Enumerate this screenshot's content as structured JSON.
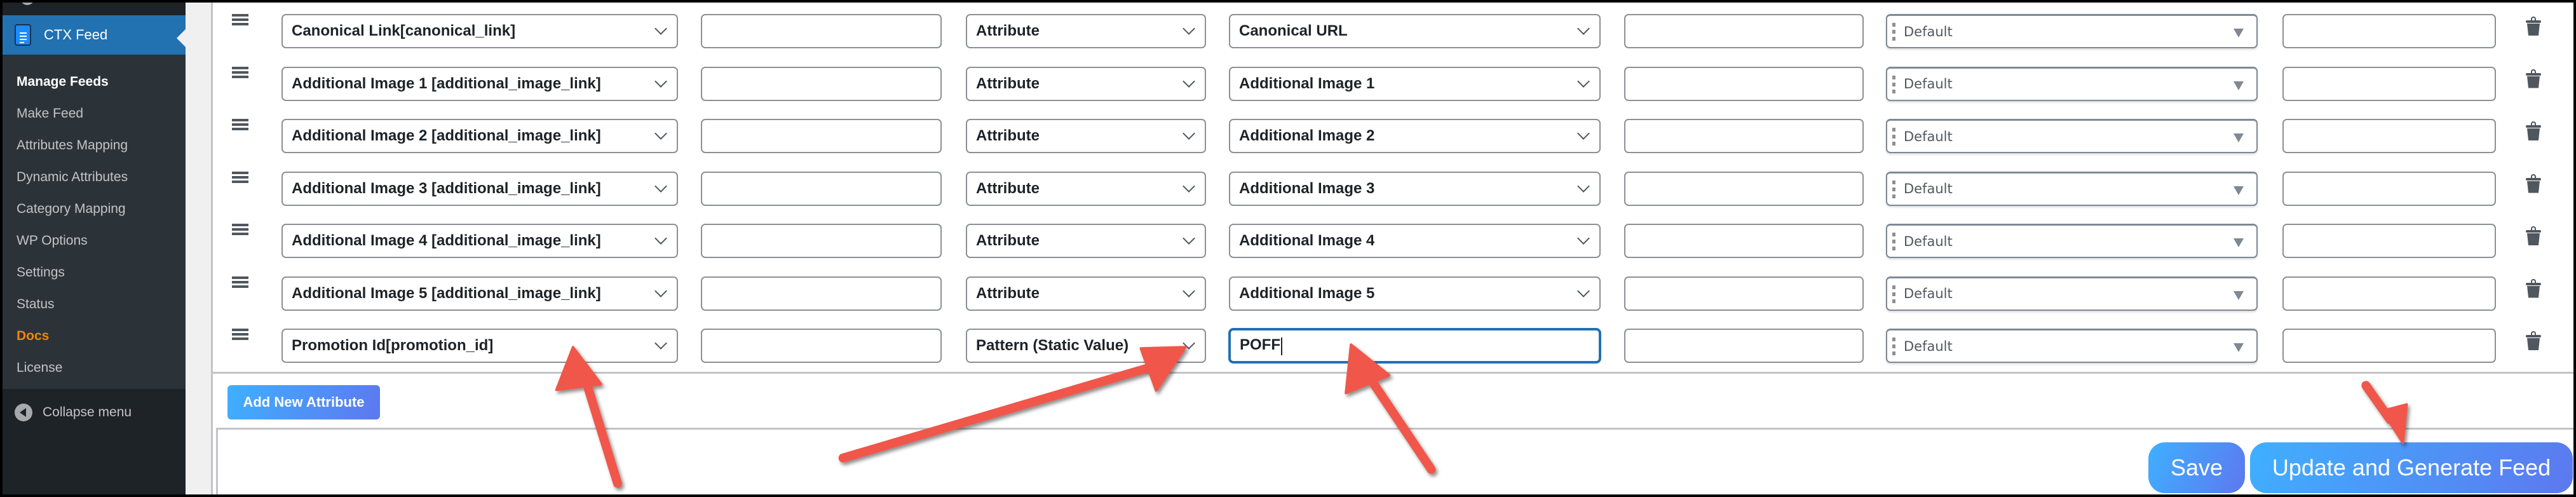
{
  "sidebar": {
    "current_menu": "CTX Feed",
    "items": [
      {
        "label": "Manage Feeds",
        "state": "active"
      },
      {
        "label": "Make Feed"
      },
      {
        "label": "Attributes Mapping"
      },
      {
        "label": "Dynamic Attributes"
      },
      {
        "label": "Category Mapping"
      },
      {
        "label": "WP Options"
      },
      {
        "label": "Settings"
      },
      {
        "label": "Status"
      },
      {
        "label": "Docs",
        "state": "highlighted"
      },
      {
        "label": "License"
      }
    ],
    "collapse_label": "Collapse menu"
  },
  "attributes": {
    "rows": [
      {
        "attribute": "Canonical Link[canonical_link]",
        "prefix": "",
        "type": "Attribute",
        "value": "Canonical URL",
        "suffix": "",
        "output_type": "Default",
        "limit": ""
      },
      {
        "attribute": "Additional Image 1 [additional_image_link]",
        "prefix": "",
        "type": "Attribute",
        "value": "Additional Image 1",
        "suffix": "",
        "output_type": "Default",
        "limit": ""
      },
      {
        "attribute": "Additional Image 2 [additional_image_link]",
        "prefix": "",
        "type": "Attribute",
        "value": "Additional Image 2",
        "suffix": "",
        "output_type": "Default",
        "limit": ""
      },
      {
        "attribute": "Additional Image 3 [additional_image_link]",
        "prefix": "",
        "type": "Attribute",
        "value": "Additional Image 3",
        "suffix": "",
        "output_type": "Default",
        "limit": ""
      },
      {
        "attribute": "Additional Image 4 [additional_image_link]",
        "prefix": "",
        "type": "Attribute",
        "value": "Additional Image 4",
        "suffix": "",
        "output_type": "Default",
        "limit": ""
      },
      {
        "attribute": "Additional Image 5 [additional_image_link]",
        "prefix": "",
        "type": "Attribute",
        "value": "Additional Image 5",
        "suffix": "",
        "output_type": "Default",
        "limit": ""
      },
      {
        "attribute": "Promotion Id[promotion_id]",
        "prefix": "",
        "type": "Pattern (Static Value)",
        "value": "POFF",
        "suffix": "",
        "output_type": "Default",
        "limit": "",
        "value_is_text_input": true,
        "focused": true
      }
    ]
  },
  "actions": {
    "add_new_attribute": "Add New Attribute",
    "save": "Save",
    "update_and_generate": "Update and Generate Feed"
  },
  "colors": {
    "sidebar_bg": "#2c3338",
    "sidebar_active": "#2271b1",
    "docs_highlight": "#f18500",
    "button_gradient_start": "#3fb0ff",
    "button_gradient_end": "#5d78ef",
    "annotation_arrow": "#f0574a",
    "focus_border": "#2271b1"
  }
}
